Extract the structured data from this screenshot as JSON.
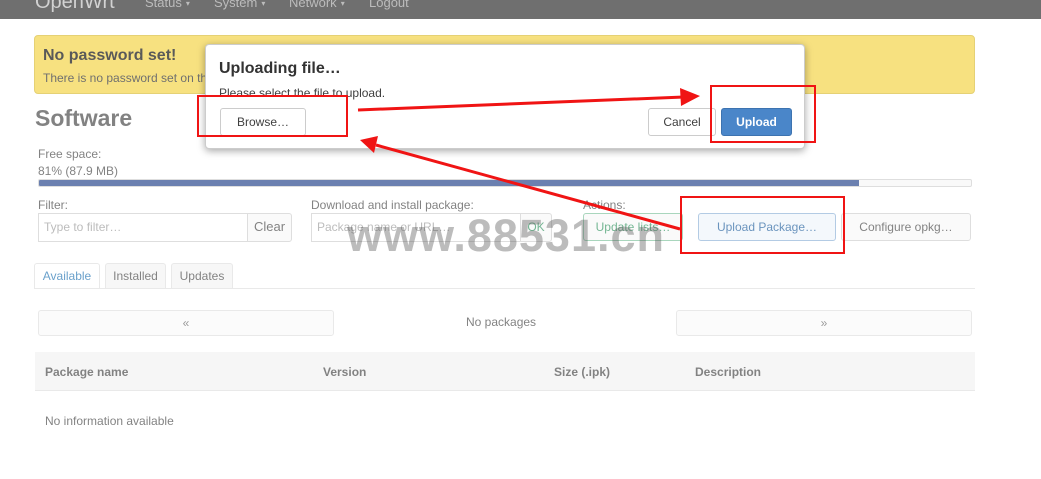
{
  "nav": {
    "brand": "OpenWrt",
    "items": [
      "Status",
      "System",
      "Network",
      "Logout"
    ]
  },
  "alert": {
    "title": "No password set!",
    "text": "There is no password set on this router. Please configure a root password to protect the web interface and enable SSH."
  },
  "page": {
    "title": "Software",
    "free_space_label": "Free space:",
    "free_space_value": "81% (87.9 MB)",
    "free_space_fraction": 0.88,
    "filter_label": "Filter:",
    "filter_placeholder": "Type to filter…",
    "clear_button": "Clear",
    "download_label": "Download and install package:",
    "download_placeholder": "Package name or URL…",
    "ok_button": "OK",
    "actions_label": "Actions:",
    "update_lists_button": "Update lists…",
    "upload_package_button": "Upload Package…",
    "configure_opkg_button": "Configure opkg…"
  },
  "tabs": [
    "Available",
    "Installed",
    "Updates"
  ],
  "pager": {
    "prev": "«",
    "next": "»",
    "status": "No packages"
  },
  "table": {
    "columns": [
      "Package name",
      "Version",
      "Size (.ipk)",
      "Description"
    ],
    "empty_text": "No information available"
  },
  "modal": {
    "title": "Uploading file…",
    "text": "Please select the file to upload.",
    "browse_button": "Browse…",
    "cancel_button": "Cancel",
    "upload_button": "Upload"
  },
  "watermark": "www.88531.cn",
  "colors": {
    "alert": "#f3d23c",
    "progress": "#1d3d86",
    "primary": "#4a86c9",
    "annotation": "#f01414"
  }
}
